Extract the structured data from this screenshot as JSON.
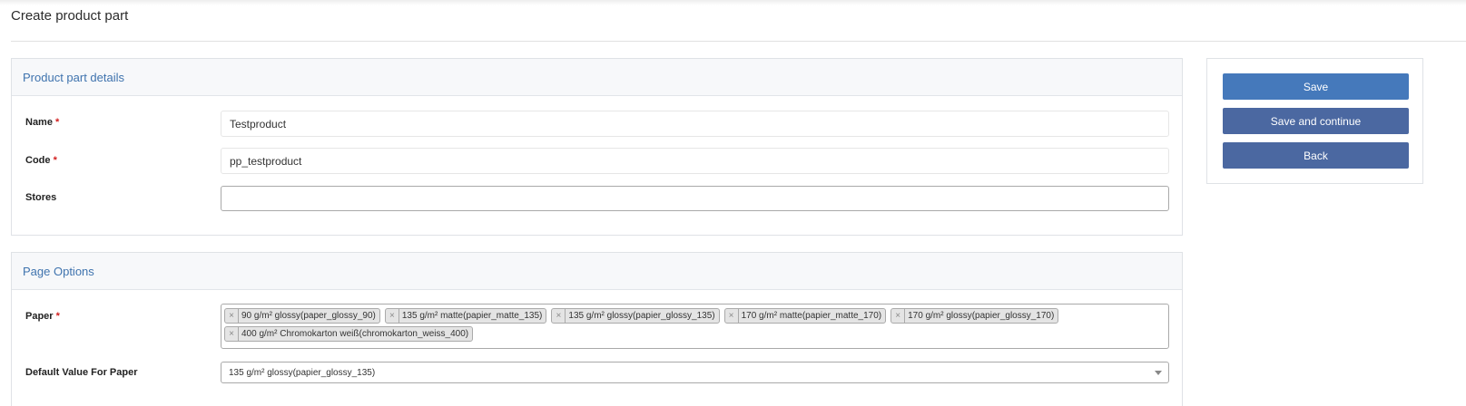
{
  "page": {
    "title": "Create product part"
  },
  "details": {
    "heading": "Product part details",
    "name_label": "Name",
    "name_value": "Testproduct",
    "code_label": "Code",
    "code_value": "pp_testproduct",
    "stores_label": "Stores",
    "stores_value": ""
  },
  "required_marker": "*",
  "page_options": {
    "heading": "Page Options",
    "paper_label": "Paper",
    "paper_tags": [
      "90 g/m² glossy(paper_glossy_90)",
      "135 g/m² matte(papier_matte_135)",
      "135 g/m² glossy(papier_glossy_135)",
      "170 g/m² matte(papier_matte_170)",
      "170 g/m² glossy(papier_glossy_170)",
      "400 g/m² Chromokarton weiß(chromokarton_weiss_400)"
    ],
    "tag_remove_glyph": "×",
    "default_label": "Default Value For Paper",
    "default_value": "135 g/m² glossy(papier_glossy_135)"
  },
  "actions": {
    "save": "Save",
    "save_continue": "Save and continue",
    "back": "Back"
  },
  "colors": {
    "primary_button": "#4579bb",
    "secondary_button": "#4b68a1",
    "panel_heading": "#3f73ae",
    "required": "#d21f1f"
  }
}
